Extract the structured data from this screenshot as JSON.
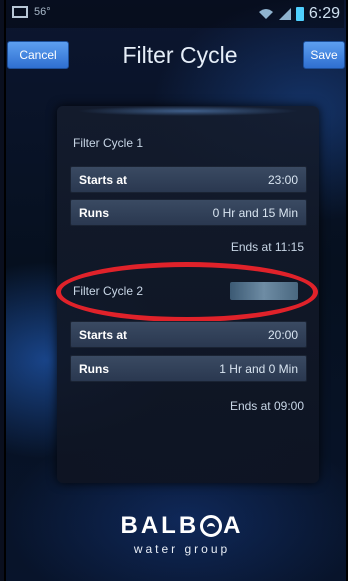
{
  "status_bar": {
    "temperature": "56°",
    "time": "6:29",
    "icons": [
      "picture-icon",
      "wifi-icon",
      "signal-icon",
      "battery-icon"
    ]
  },
  "header": {
    "cancel_label": "Cancel",
    "title": "Filter Cycle",
    "save_label": "Save"
  },
  "filter_cycle_1": {
    "label": "Filter Cycle 1",
    "starts_label": "Starts at",
    "starts_value": "23:00",
    "runs_label": "Runs",
    "runs_value": "0 Hr and 15 Min",
    "ends": "Ends at 11:15"
  },
  "filter_cycle_2": {
    "label": "Filter Cycle 2",
    "starts_label": "Starts at",
    "starts_value": "20:00",
    "runs_label": "Runs",
    "runs_value": "1 Hr and 0 Min",
    "ends": "Ends at 09:00"
  },
  "logo": {
    "name_part1": "BALB",
    "name_part2": "A",
    "tagline": "water group"
  },
  "colors": {
    "button_blue": "#3f84e0",
    "highlight_red": "#e0222a",
    "background_dark": "#0a0f1e"
  }
}
